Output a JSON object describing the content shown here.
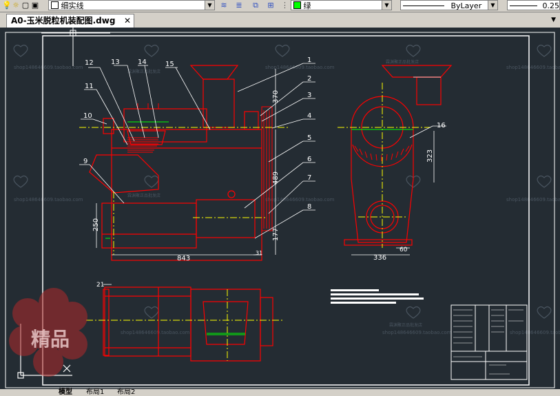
{
  "toolbar": {
    "linetype_combo": {
      "value": "细实线"
    },
    "color_combo": {
      "value": "绿",
      "swatch": "#00ff00"
    },
    "linetype2_combo": {
      "value": "ByLayer"
    },
    "lineweight_combo": {
      "value": "0.25"
    }
  },
  "document_tab": {
    "label": "A0-玉米脱粒机装配图.dwg",
    "close_glyph": "✕"
  },
  "layout_tabs": [
    "模型",
    "布局1",
    "布局2"
  ],
  "drawing": {
    "part_numbers": [
      "1",
      "2",
      "3",
      "4",
      "5",
      "6",
      "7",
      "8",
      "9",
      "10",
      "11",
      "12",
      "13",
      "14",
      "15",
      "16"
    ],
    "dimensions": {
      "d843": "843",
      "d250": "250",
      "d370": "370",
      "d489": "489",
      "d177": "177",
      "d31": "31",
      "d336": "336",
      "d323": "323",
      "d60": "60",
      "d21": "21"
    },
    "watermark_text": "shop148646609.taobao.com",
    "watermark_cn": "霖渊聚正品批发店",
    "logo_text": "精品",
    "colors": {
      "background": "#242c33",
      "outline": "#ff0000",
      "centerline": "#ffff00",
      "leader": "#ffffff",
      "green": "#00ff00"
    }
  }
}
